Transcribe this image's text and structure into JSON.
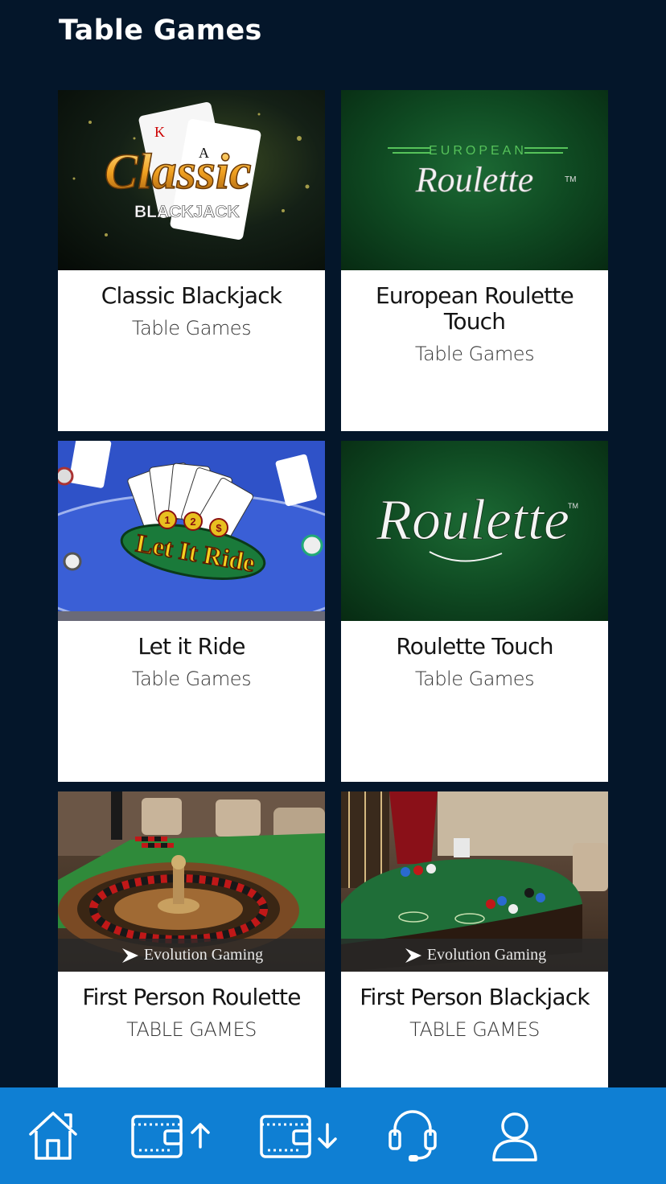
{
  "header": {
    "title": "Table Games"
  },
  "games": [
    {
      "title": "Classic Blackjack",
      "category": "Table Games",
      "art_text": [
        "Classic",
        "BLACKJACK"
      ]
    },
    {
      "title": "European Roulette Touch",
      "category": "Table Games",
      "art_text": [
        "EUROPEAN",
        "Roulette",
        "TM"
      ]
    },
    {
      "title": "Let it Ride",
      "category": "Table Games",
      "art_text": [
        "Let It Ride",
        "1",
        "2",
        "$"
      ]
    },
    {
      "title": "Roulette Touch",
      "category": "Table Games",
      "art_text": [
        "Roulette",
        "TM"
      ]
    },
    {
      "title": "First Person Roulette",
      "category": "TABLE GAMES",
      "provider": "Evolution Gaming"
    },
    {
      "title": "First Person Blackjack",
      "category": "TABLE GAMES",
      "provider": "Evolution Gaming"
    }
  ],
  "nav": [
    {
      "icon": "home-icon"
    },
    {
      "icon": "wallet-deposit-icon"
    },
    {
      "icon": "wallet-withdraw-icon"
    },
    {
      "icon": "headset-support-icon"
    },
    {
      "icon": "user-account-icon"
    }
  ],
  "colors": {
    "background": "#04162a",
    "nav": "#0f7fd3",
    "card": "#ffffff"
  }
}
